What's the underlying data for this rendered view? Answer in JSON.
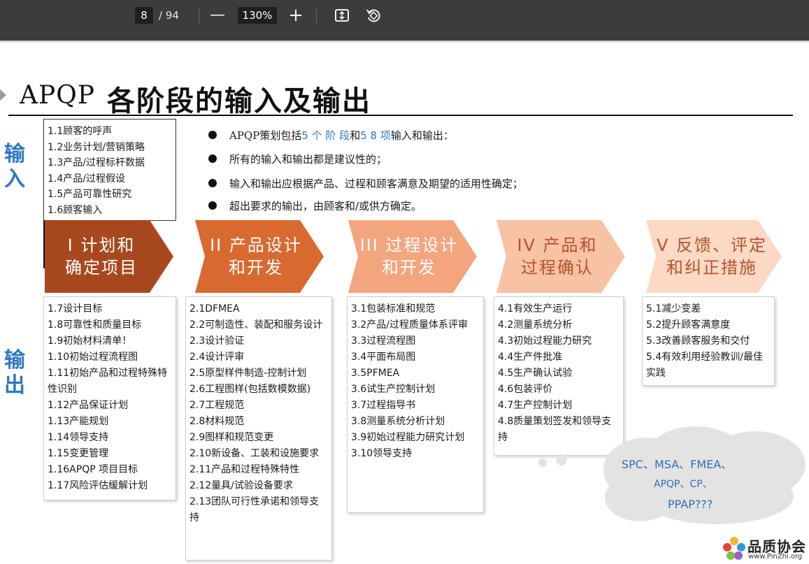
{
  "toolbar": {
    "page_current": "8",
    "page_total": "/ 94",
    "zoom_out": "—",
    "zoom_level": "130%",
    "zoom_in": "+"
  },
  "slide": {
    "title_latin": "APQP",
    "title_cn": "各阶段的输入及输出",
    "label_input": [
      "输",
      "入"
    ],
    "label_output": [
      "输",
      "出"
    ],
    "inputs": [
      "1.1顾客的呼声",
      "1.2业务计划/营销策略",
      "1.3产品/过程标杆数据",
      "1.4产品/过程假设",
      "1.5产品可靠性研究",
      "1.6顾客输入"
    ],
    "bullets": {
      "b1_a": "APQP策划包括",
      "b1_b": "5 个 阶 段",
      "b1_c": "和",
      "b1_d": "5 8 项",
      "b1_e": "输入和输出：",
      "b2": "所有的输入和输出都是建议性的；",
      "b3": "输入和输出应根据产品、过程和顾客满意及期望的适用性确定；",
      "b4": "超出要求的输出，由顾客和/或供方确定。"
    },
    "phases": [
      {
        "line1": "I 计划和",
        "line2": "确定项目",
        "color": "#a8481e"
      },
      {
        "line1": "II 产品设计",
        "line2": "和开发",
        "color": "#d86a30"
      },
      {
        "line1": "III 过程设计",
        "line2": "和开发",
        "color": "#f3a57e"
      },
      {
        "line1": "IV 产品和",
        "line2": "过程确认",
        "color": "#f8c2a4"
      },
      {
        "line1": "V 反馈、评定",
        "line2": "和纠正措施",
        "color": "#fbd9c5"
      }
    ],
    "outputs1": [
      "1.7设计目标",
      "1.8可靠性和质量目标",
      "1.9初始材料清单！",
      "1.10初始过程流程图",
      "1.11初始产品和过程特殊特性识别",
      "1.12产品保证计划",
      "1.13产能规划",
      "1.14领导支持",
      "1.15变更管理",
      "1.16APQP 项目目标",
      "1.17风险评估缓解计划"
    ],
    "outputs2": [
      "2.1DFMEA",
      "2.2可制造性、装配和服务设计",
      "2.3设计验证",
      "2.4设计评审",
      "2.5原型样件制造-控制计划",
      "2.6工程图样(包括数模数据)",
      "2.7工程规范",
      "2.8材料规范",
      "2.9图样和规范变更",
      "2.10新设备、工装和设施要求",
      "2.11产品和过程特殊特性",
      "2.12量具/试验设备要求",
      "2.13团队可行性承诺和领导支持"
    ],
    "outputs3": [
      "3.1包装标准和规范",
      "3.2产品/过程质量体系评审",
      "3.3过程流程图",
      "3.4平面布局图",
      "3.5PFMEA",
      "3.6试生产控制计划",
      "3.7过程指导书",
      "3.8测量系统分析计划",
      "3.9初始过程能力研究计划",
      "3.10领导支持"
    ],
    "outputs4": [
      "4.1有效生产运行",
      "4.2测量系统分析",
      "4.3初始过程能力研究",
      "4.4生产件批准",
      "4.5生产确认试验",
      "4.6包装评价",
      "4.7生产控制计划",
      "4.8质量策划签发和领导支持"
    ],
    "outputs5": [
      "5.1减少变差",
      "5.2提升顾客满意度",
      "5.3改善顾客服务和交付",
      "5.4有效利用经验教训/最佳实践"
    ],
    "cloud": {
      "line1": "SPC、MSA、FMEA、",
      "line2": "APQP、CP、",
      "line3": "PPAP???"
    },
    "logo": {
      "name": "品质协会",
      "url": "www.PinZhi.org"
    }
  }
}
